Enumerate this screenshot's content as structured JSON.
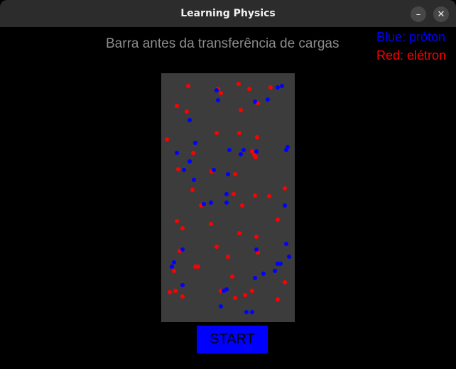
{
  "window": {
    "title": "Learning Physics",
    "minimize_icon": "minimize-icon",
    "close_icon": "close-icon"
  },
  "main": {
    "heading": "Barra antes da transferência de cargas",
    "legend": {
      "proton_label": "Blue: próton",
      "electron_label": "Red: elétron"
    },
    "start_button": "START"
  },
  "colors": {
    "proton": "#0000ff",
    "electron": "#ff0000",
    "bar": "#3c3c3c"
  }
}
